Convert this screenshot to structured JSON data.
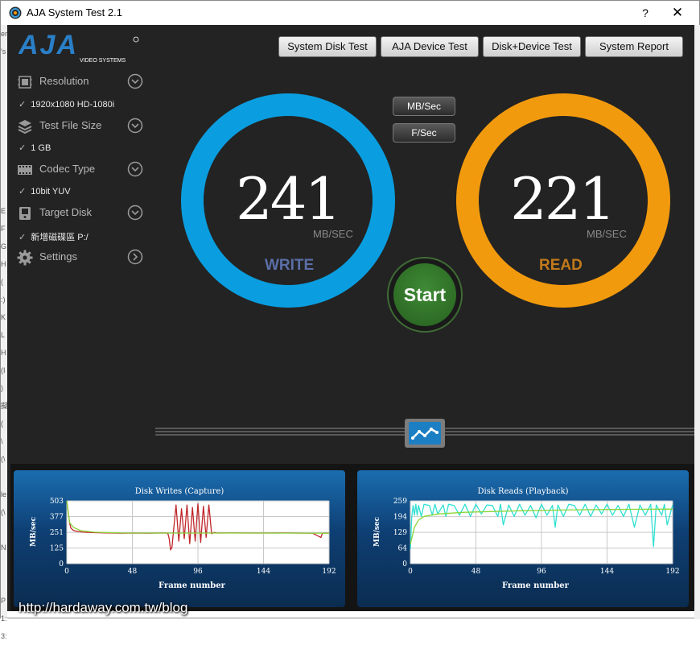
{
  "window": {
    "title": "AJA System Test 2.1",
    "help_label": "?",
    "close_label": "✕"
  },
  "outer_strip_chars": [
    "er",
    "'s",
    "",
    "",
    "",
    "",
    "",
    "",
    "",
    "",
    "E",
    "F",
    "G",
    "H",
    "(",
    ":)",
    "K",
    "L",
    "H",
    "(I",
    ")",
    "擬",
    "(",
    "\\",
    "(\\",
    "",
    "le",
    "(\\",
    "",
    "N",
    "",
    "",
    "P",
    "1:",
    "3:"
  ],
  "logo": {
    "brand": "AJA",
    "tagline": "VIDEO SYSTEMS",
    "brand_color": "#2a7fc7"
  },
  "tabs": [
    {
      "label": "System Disk Test"
    },
    {
      "label": "AJA Device Test"
    },
    {
      "label": "Disk+Device Test"
    },
    {
      "label": "System Report"
    }
  ],
  "sidebar": {
    "items": [
      {
        "label": "Resolution",
        "icon": "resolution-icon",
        "value": "1920x1080 HD-1080i"
      },
      {
        "label": "Test File Size",
        "icon": "stack-icon",
        "value": "1 GB"
      },
      {
        "label": "Codec Type",
        "icon": "film-icon",
        "value": "10bit YUV"
      },
      {
        "label": "Target Disk",
        "icon": "disk-icon",
        "value": "新增磁碟區 P:/"
      },
      {
        "label": "Settings",
        "icon": "gear-icon",
        "value": ""
      }
    ],
    "check": "✓"
  },
  "units_buttons": {
    "mbps": "MB/Sec",
    "fps": "F/Sec"
  },
  "write": {
    "value": "241",
    "units": "MB/SEC",
    "label": "WRITE",
    "ring_color": "#0a9ee0",
    "label_color": "#5b6fa8"
  },
  "read": {
    "value": "221",
    "units": "MB/SEC",
    "label": "READ",
    "ring_color": "#f29a0e",
    "label_color": "#c27a1a"
  },
  "start_label": "Start",
  "graph_toggle_icon": "graph-icon",
  "chart_data": [
    {
      "type": "line",
      "title": "Disk Writes (Capture)",
      "xlabel": "Frame number",
      "ylabel": "MB/sec",
      "xlim": [
        0,
        192
      ],
      "ylim": [
        0,
        503
      ],
      "xticks": [
        0,
        48,
        96,
        144,
        192
      ],
      "yticks": [
        0,
        125,
        251,
        377,
        503
      ],
      "ytick_labels": [
        "0",
        "125",
        "251",
        "377",
        "503"
      ],
      "grid": true,
      "series": [
        {
          "color": "#c0262a",
          "x": [
            0,
            1,
            2,
            3,
            5,
            8,
            12,
            20,
            30,
            40,
            50,
            60,
            70,
            74,
            75,
            76,
            77,
            78,
            80,
            82,
            84,
            86,
            88,
            90,
            92,
            94,
            96,
            98,
            100,
            102,
            104,
            106,
            108,
            110,
            120,
            140,
            160,
            180,
            186,
            187,
            188,
            190,
            192
          ],
          "y": [
            503,
            420,
            330,
            285,
            265,
            258,
            252,
            248,
            246,
            244,
            245,
            244,
            246,
            244,
            200,
            110,
            130,
            246,
            470,
            180,
            440,
            200,
            470,
            160,
            450,
            180,
            480,
            170,
            460,
            210,
            470,
            240,
            250,
            245,
            246,
            245,
            246,
            244,
            210,
            240,
            246,
            245,
            244
          ]
        },
        {
          "color": "#8ad63a",
          "x": [
            0,
            2,
            5,
            10,
            20,
            40,
            80,
            120,
            192
          ],
          "y": [
            503,
            330,
            290,
            265,
            252,
            246,
            245,
            245,
            244
          ]
        }
      ]
    },
    {
      "type": "line",
      "title": "Disk Reads (Playback)",
      "xlabel": "Frame number",
      "ylabel": "MB/sec",
      "xlim": [
        0,
        192
      ],
      "ylim": [
        0,
        259
      ],
      "xticks": [
        0,
        48,
        96,
        144,
        192
      ],
      "yticks": [
        0,
        64,
        129,
        194,
        259
      ],
      "ytick_labels": [
        "0",
        "64",
        "129",
        "194",
        "259"
      ],
      "grid": true,
      "series": [
        {
          "color": "#2fe0d2",
          "x": [
            0,
            1,
            2,
            3,
            4,
            5,
            6,
            8,
            10,
            14,
            16,
            18,
            20,
            24,
            26,
            28,
            32,
            36,
            40,
            44,
            48,
            52,
            56,
            60,
            64,
            66,
            68,
            72,
            76,
            80,
            84,
            88,
            92,
            96,
            100,
            104,
            106,
            108,
            112,
            116,
            120,
            124,
            128,
            132,
            136,
            140,
            144,
            148,
            152,
            156,
            160,
            164,
            168,
            172,
            176,
            178,
            180,
            184,
            186,
            188,
            192
          ],
          "y": [
            60,
            190,
            240,
            200,
            245,
            200,
            240,
            195,
            245,
            240,
            200,
            245,
            205,
            242,
            195,
            245,
            240,
            200,
            245,
            195,
            245,
            205,
            242,
            240,
            195,
            245,
            160,
            242,
            195,
            245,
            200,
            240,
            190,
            245,
            200,
            240,
            150,
            242,
            195,
            245,
            240,
            200,
            245,
            195,
            242,
            205,
            245,
            200,
            240,
            195,
            245,
            150,
            242,
            200,
            245,
            70,
            242,
            200,
            245,
            160,
            242
          ]
        },
        {
          "color": "#8ad63a",
          "x": [
            0,
            3,
            6,
            10,
            20,
            40,
            80,
            120,
            160,
            192
          ],
          "y": [
            80,
            150,
            180,
            195,
            205,
            212,
            218,
            222,
            224,
            225
          ]
        }
      ]
    }
  ],
  "watermark": "http://hardaway.com.tw/blog"
}
